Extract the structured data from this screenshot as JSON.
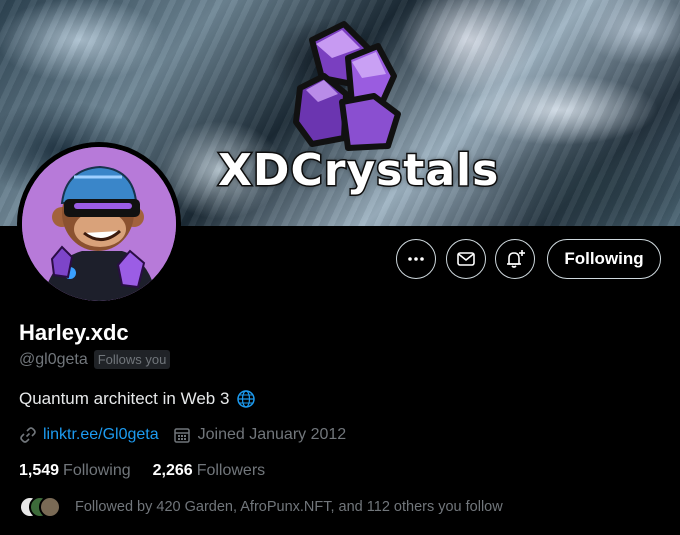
{
  "banner": {
    "brand_text": "XDCrystals"
  },
  "profile": {
    "display_name": "Harley.xdc",
    "handle": "@gl0geta",
    "follows_you": "Follows you",
    "bio": "Quantum architect in Web 3",
    "bio_icon": "globe-icon",
    "link": "linktr.ee/Gl0geta",
    "joined": "Joined January 2012"
  },
  "actions": {
    "more_icon": "more-icon",
    "message_icon": "envelope-icon",
    "notify_icon": "bell-plus-icon",
    "following_label": "Following"
  },
  "stats": {
    "following_count": "1,549",
    "following_label": "Following",
    "followers_count": "2,266",
    "followers_label": "Followers"
  },
  "followed_by": "Followed by 420 Garden, AfroPunx.NFT, and 112 others you follow",
  "colors": {
    "accent": "#1d9bf0",
    "muted": "#71767b",
    "crystal": "#8a4fd0",
    "avatar_bg": "#b77ad9"
  }
}
